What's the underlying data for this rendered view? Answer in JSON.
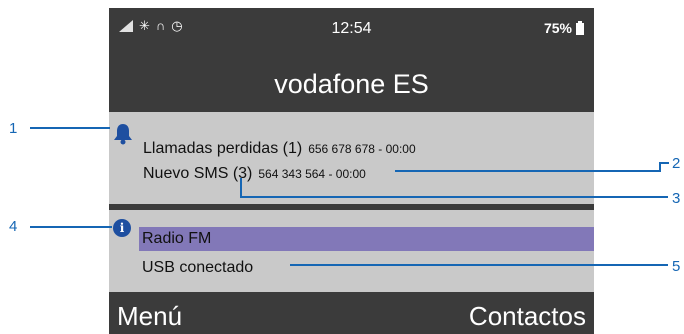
{
  "status_bar": {
    "time": "12:54",
    "battery": "75%",
    "icons": [
      "signal-icon",
      "bluetooth-icon",
      "headphones-icon",
      "alarm-icon",
      "battery-icon"
    ]
  },
  "carrier": "vodafone ES",
  "notifications": {
    "icon": "bell-icon",
    "items": [
      {
        "label": "Llamadas perdidas (1)",
        "detail": "656 678 678 - 00:00"
      },
      {
        "label": "Nuevo SMS (3)",
        "detail": "564 343 564 - 00:00"
      }
    ]
  },
  "info": {
    "icon": "info-icon",
    "icon_glyph": "i",
    "items": [
      "Radio FM",
      "USB conectado"
    ]
  },
  "softkeys": {
    "left": "Menú",
    "right": "Contactos"
  },
  "callouts": [
    "1",
    "2",
    "3",
    "4",
    "5"
  ],
  "colors": {
    "callout": "#1566b4",
    "highlight": "#8278b8",
    "panel": "#c9c9c9",
    "screen": "#3b3b3b"
  }
}
